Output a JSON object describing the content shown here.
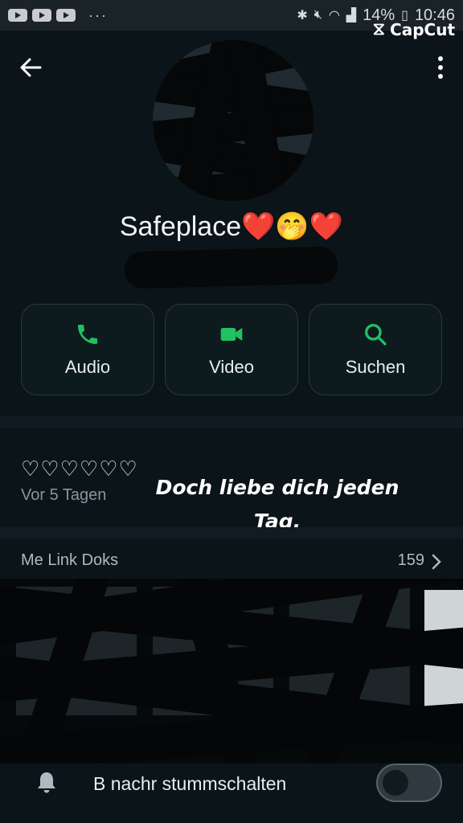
{
  "status_bar": {
    "battery": "14%",
    "time": "10:46",
    "overflow": "···"
  },
  "watermark": {
    "text": "CapCut"
  },
  "contact": {
    "name": "Safeplace❤️🤭❤️"
  },
  "actions": [
    {
      "label": "Audio",
      "icon": "phone-icon"
    },
    {
      "label": "Video",
      "icon": "video-camera-icon"
    },
    {
      "label": "Suchen",
      "icon": "search-icon"
    }
  ],
  "about": {
    "status": "♡♡♡♡♡♡",
    "time": "Vor 5 Tagen"
  },
  "overlay": {
    "line1": "Doch liebe dich jeden",
    "line2": "Tag."
  },
  "media": {
    "label": "Me      Link      Doks",
    "count": "159"
  },
  "notifications": {
    "label": "B    nachr   stummschalten"
  },
  "colors": {
    "accent": "#21c063",
    "background": "#0b1418",
    "muted_text": "#8696a0"
  }
}
